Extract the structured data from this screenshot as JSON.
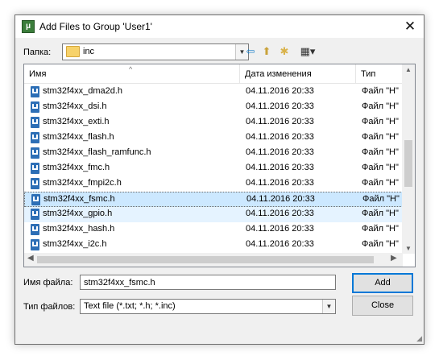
{
  "window": {
    "title": "Add Files to Group 'User1'",
    "close_glyph": "✕"
  },
  "lookin": {
    "label": "Папка:",
    "value": "inc"
  },
  "toolbar": [
    {
      "name": "back-icon",
      "glyph": "⇦",
      "color": "#1a7fc9"
    },
    {
      "name": "up-folder-icon",
      "glyph": "⬆",
      "color": "#c9a23a"
    },
    {
      "name": "new-folder-icon",
      "glyph": "✱",
      "color": "#d9b24a"
    },
    {
      "name": "view-menu-icon",
      "glyph": "▦▾",
      "color": "#333333"
    }
  ],
  "columns": {
    "name": "Имя",
    "date": "Дата изменения",
    "type": "Тип"
  },
  "files": [
    {
      "name": "stm32f4xx_dma2d.h",
      "date": "04.11.2016 20:33",
      "type": "Файл \"H\""
    },
    {
      "name": "stm32f4xx_dsi.h",
      "date": "04.11.2016 20:33",
      "type": "Файл \"H\""
    },
    {
      "name": "stm32f4xx_exti.h",
      "date": "04.11.2016 20:33",
      "type": "Файл \"H\""
    },
    {
      "name": "stm32f4xx_flash.h",
      "date": "04.11.2016 20:33",
      "type": "Файл \"H\""
    },
    {
      "name": "stm32f4xx_flash_ramfunc.h",
      "date": "04.11.2016 20:33",
      "type": "Файл \"H\""
    },
    {
      "name": "stm32f4xx_fmc.h",
      "date": "04.11.2016 20:33",
      "type": "Файл \"H\""
    },
    {
      "name": "stm32f4xx_fmpi2c.h",
      "date": "04.11.2016 20:33",
      "type": "Файл \"H\""
    },
    {
      "name": "stm32f4xx_fsmc.h",
      "date": "04.11.2016 20:33",
      "type": "Файл \"H\""
    },
    {
      "name": "stm32f4xx_gpio.h",
      "date": "04.11.2016 20:33",
      "type": "Файл \"H\""
    },
    {
      "name": "stm32f4xx_hash.h",
      "date": "04.11.2016 20:33",
      "type": "Файл \"H\""
    },
    {
      "name": "stm32f4xx_i2c.h",
      "date": "04.11.2016 20:33",
      "type": "Файл \"H\""
    }
  ],
  "selected_index": 7,
  "hover_index": 8,
  "filename": {
    "label": "Имя файла:",
    "value": "stm32f4xx_fsmc.h"
  },
  "filetype": {
    "label": "Тип файлов:",
    "value": "Text file (*.txt; *.h; *.inc)"
  },
  "buttons": {
    "add": "Add",
    "close": "Close"
  }
}
